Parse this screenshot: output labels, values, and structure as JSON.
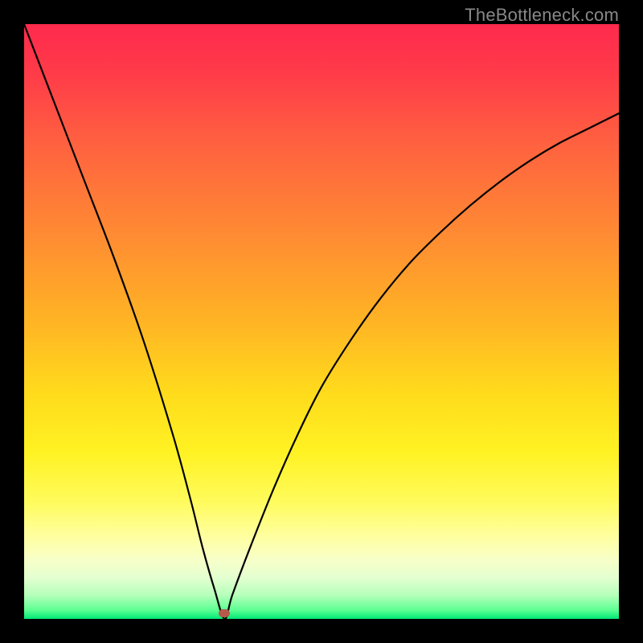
{
  "watermark": "TheBottleneck.com",
  "chart_data": {
    "type": "line",
    "title": "",
    "xlabel": "",
    "ylabel": "",
    "xlim": [
      0,
      100
    ],
    "ylim": [
      0,
      100
    ],
    "grid": false,
    "series": [
      {
        "name": "bottleneck-curve",
        "x": [
          0,
          5,
          10,
          15,
          20,
          25,
          28,
          30,
          32,
          33.7,
          35,
          38,
          42,
          46,
          50,
          55,
          60,
          65,
          70,
          75,
          80,
          85,
          90,
          95,
          100
        ],
        "y": [
          100,
          87,
          74,
          61,
          47,
          31,
          20,
          12,
          5,
          0,
          4,
          12,
          22,
          31,
          39,
          47,
          54,
          60,
          65,
          69.5,
          73.5,
          77,
          80,
          82.5,
          85
        ]
      }
    ],
    "marker": {
      "x": 33.7,
      "y": 1.0,
      "color": "#b55a4a"
    },
    "background_gradient": {
      "stops": [
        {
          "offset": 0.0,
          "color": "#ff2a4d"
        },
        {
          "offset": 0.08,
          "color": "#ff3a49"
        },
        {
          "offset": 0.2,
          "color": "#ff6140"
        },
        {
          "offset": 0.35,
          "color": "#ff8a33"
        },
        {
          "offset": 0.5,
          "color": "#ffb424"
        },
        {
          "offset": 0.62,
          "color": "#ffdb1c"
        },
        {
          "offset": 0.72,
          "color": "#fff223"
        },
        {
          "offset": 0.8,
          "color": "#fffb5a"
        },
        {
          "offset": 0.86,
          "color": "#ffff9e"
        },
        {
          "offset": 0.9,
          "color": "#f8ffc8"
        },
        {
          "offset": 0.93,
          "color": "#e4ffd0"
        },
        {
          "offset": 0.96,
          "color": "#b6ffba"
        },
        {
          "offset": 0.985,
          "color": "#5dff93"
        },
        {
          "offset": 1.0,
          "color": "#00e877"
        }
      ]
    }
  }
}
